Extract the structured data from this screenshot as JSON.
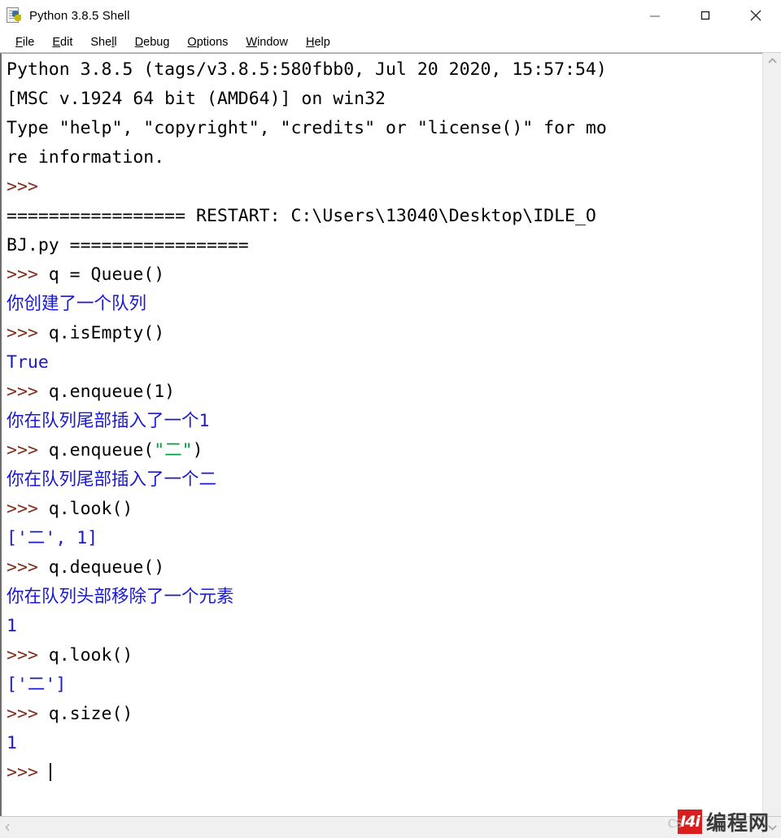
{
  "window": {
    "title": "Python 3.8.5 Shell",
    "icon": "python-idle-icon",
    "controls": {
      "minimize": "minimize-button",
      "maximize": "maximize-button",
      "close": "close-button"
    }
  },
  "menubar": {
    "items": [
      {
        "label": "File",
        "accel_index": 0
      },
      {
        "label": "Edit",
        "accel_index": 0
      },
      {
        "label": "Shell",
        "accel_index": 3
      },
      {
        "label": "Debug",
        "accel_index": 0
      },
      {
        "label": "Options",
        "accel_index": 0
      },
      {
        "label": "Window",
        "accel_index": 0
      },
      {
        "label": "Help",
        "accel_index": 0
      }
    ]
  },
  "console": {
    "lines": [
      {
        "segments": [
          {
            "text": "Python 3.8.5 (tags/v3.8.5:580fbb0, Jul 20 2020, 15:57:54)",
            "style": "plain"
          }
        ]
      },
      {
        "segments": [
          {
            "text": "[MSC v.1924 64 bit (AMD64)] on win32",
            "style": "plain"
          }
        ]
      },
      {
        "segments": [
          {
            "text": "Type \"help\", \"copyright\", \"credits\" or \"license()\" for mo",
            "style": "plain"
          }
        ]
      },
      {
        "segments": [
          {
            "text": "re information.",
            "style": "plain"
          }
        ]
      },
      {
        "segments": [
          {
            "text": ">>> ",
            "style": "prompt"
          }
        ]
      },
      {
        "segments": [
          {
            "text": "================= RESTART: C:\\Users\\13040\\Desktop\\IDLE_O",
            "style": "plain"
          }
        ]
      },
      {
        "segments": [
          {
            "text": "BJ.py =================",
            "style": "plain"
          }
        ]
      },
      {
        "segments": [
          {
            "text": ">>> ",
            "style": "prompt"
          },
          {
            "text": "q = Queue()",
            "style": "code"
          }
        ]
      },
      {
        "segments": [
          {
            "text": "你创建了一个队列",
            "style": "out"
          }
        ]
      },
      {
        "segments": [
          {
            "text": ">>> ",
            "style": "prompt"
          },
          {
            "text": "q.isEmpty()",
            "style": "code"
          }
        ]
      },
      {
        "segments": [
          {
            "text": "True",
            "style": "out"
          }
        ]
      },
      {
        "segments": [
          {
            "text": ">>> ",
            "style": "prompt"
          },
          {
            "text": "q.enqueue(1)",
            "style": "code"
          }
        ]
      },
      {
        "segments": [
          {
            "text": "你在队列尾部插入了一个1",
            "style": "out"
          }
        ]
      },
      {
        "segments": [
          {
            "text": ">>> ",
            "style": "prompt"
          },
          {
            "text": "q.enqueue(",
            "style": "code"
          },
          {
            "text": "\"二\"",
            "style": "str"
          },
          {
            "text": ")",
            "style": "code"
          }
        ]
      },
      {
        "segments": [
          {
            "text": "你在队列尾部插入了一个二",
            "style": "out"
          }
        ]
      },
      {
        "segments": [
          {
            "text": ">>> ",
            "style": "prompt"
          },
          {
            "text": "q.look()",
            "style": "code"
          }
        ]
      },
      {
        "segments": [
          {
            "text": "['二', 1]",
            "style": "out"
          }
        ]
      },
      {
        "segments": [
          {
            "text": ">>> ",
            "style": "prompt"
          },
          {
            "text": "q.dequeue()",
            "style": "code"
          }
        ]
      },
      {
        "segments": [
          {
            "text": "你在队列头部移除了一个元素",
            "style": "out"
          }
        ]
      },
      {
        "segments": [
          {
            "text": "1",
            "style": "out"
          }
        ]
      },
      {
        "segments": [
          {
            "text": ">>> ",
            "style": "prompt"
          },
          {
            "text": "q.look()",
            "style": "code"
          }
        ]
      },
      {
        "segments": [
          {
            "text": "['二']",
            "style": "out"
          }
        ]
      },
      {
        "segments": [
          {
            "text": ">>> ",
            "style": "prompt"
          },
          {
            "text": "q.size()",
            "style": "code"
          }
        ]
      },
      {
        "segments": [
          {
            "text": "1",
            "style": "out"
          }
        ]
      },
      {
        "segments": [
          {
            "text": ">>> ",
            "style": "prompt"
          },
          {
            "caret": true
          }
        ]
      }
    ],
    "colors": {
      "prompt": "#7f2f1f",
      "code": "#000000",
      "output": "#1919d1",
      "string": "#00a33f",
      "background": "#ffffff"
    }
  },
  "scrollbars": {
    "vertical": {
      "up_arrow": "chevron-up-icon",
      "down_arrow": "chevron-down-icon"
    },
    "horizontal": {
      "left_arrow": "chevron-left-icon",
      "right_arrow": "chevron-right-icon"
    }
  },
  "watermark": {
    "ghost": "cs",
    "logo_text": "I4i",
    "text": "编程网",
    "logo_color": "#d81e1e"
  }
}
